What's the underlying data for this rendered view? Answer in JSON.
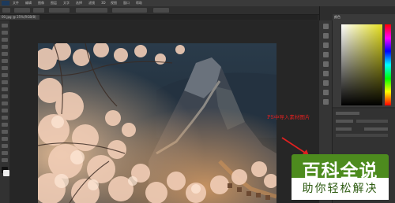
{
  "menubar": {
    "items": [
      "文件",
      "编辑",
      "图像",
      "图层",
      "文字",
      "选择",
      "滤镜",
      "3D",
      "视图",
      "窗口",
      "帮助"
    ]
  },
  "document": {
    "tab_title": "00.jpg @ 25%(RGB/8)"
  },
  "annotation": {
    "text": "PS中导入素材图片",
    "color": "#e02020"
  },
  "panels": {
    "color_panel_title": "颜色"
  },
  "watermark": {
    "title": "百科全说",
    "subtitle": "助你轻松解决",
    "brand_color": "#4d8b1e"
  }
}
